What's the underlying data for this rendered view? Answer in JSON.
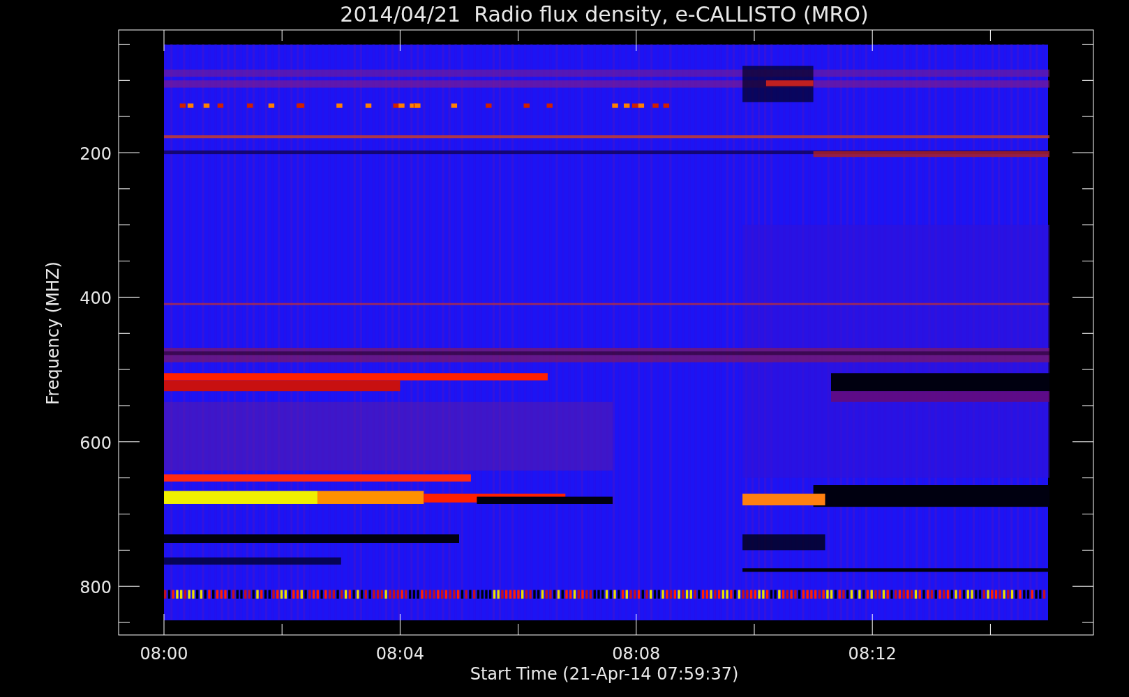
{
  "title": "2014/04/21  Radio flux density, e-CALLISTO (MRO)",
  "y_axis": {
    "label": "Frequency (MHZ)",
    "ticks": [
      "200",
      "400",
      "600",
      "800"
    ]
  },
  "x_axis": {
    "label": "Start Time (21-Apr-14 07:59:37)",
    "ticks": [
      "08:00",
      "08:04",
      "08:08",
      "08:12"
    ]
  }
}
